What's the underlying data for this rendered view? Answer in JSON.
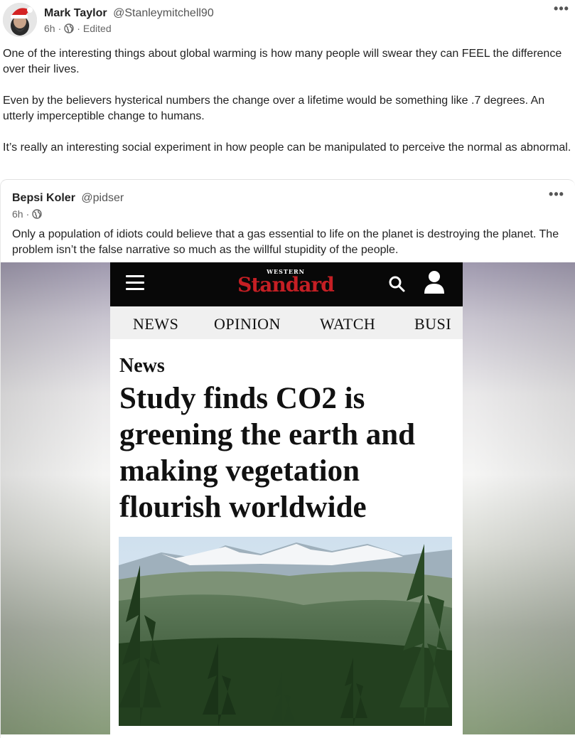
{
  "post": {
    "author_name": "Mark Taylor",
    "author_handle": "@Stanleymitchell90",
    "time": "6h",
    "separator": "·",
    "edited": "Edited",
    "more_label": "•••",
    "paragraphs": [
      "One of the interesting things about global warming is how many people will swear they can FEEL the difference over their lives.",
      "Even by the believers hysterical numbers the change over a lifetime would be something like .7 degrees. An utterly imperceptible change to humans.",
      "It’s really an interesting social experiment in how people can be manipulated to perceive the normal as abnormal."
    ]
  },
  "quote": {
    "author_name": "Bepsi Koler",
    "author_handle": "@pidser",
    "time": "6h",
    "separator": "·",
    "more_label": "•••",
    "text": "Only a population of idiots could believe that a gas essential to life on the planet is destroying the planet. The problem isn’t the false narrative so much as the willful stupidity of the people."
  },
  "article_screenshot": {
    "brand_small": "WESTERN",
    "brand_big": "Standard",
    "nav": [
      "NEWS",
      "OPINION",
      "WATCH",
      "BUSI"
    ],
    "section": "News",
    "headline": "Study finds CO2 is greening the earth and making vegetation flourish worldwide"
  },
  "colors": {
    "brand_red": "#c51f24",
    "site_bar": "#080808",
    "nav_bg": "#f0f0f0"
  },
  "icons": {
    "post_globe": "globe-icon",
    "post_more": "more-options-icon",
    "site_menu": "hamburger-menu-icon",
    "site_search": "search-icon",
    "site_user": "user-icon"
  }
}
